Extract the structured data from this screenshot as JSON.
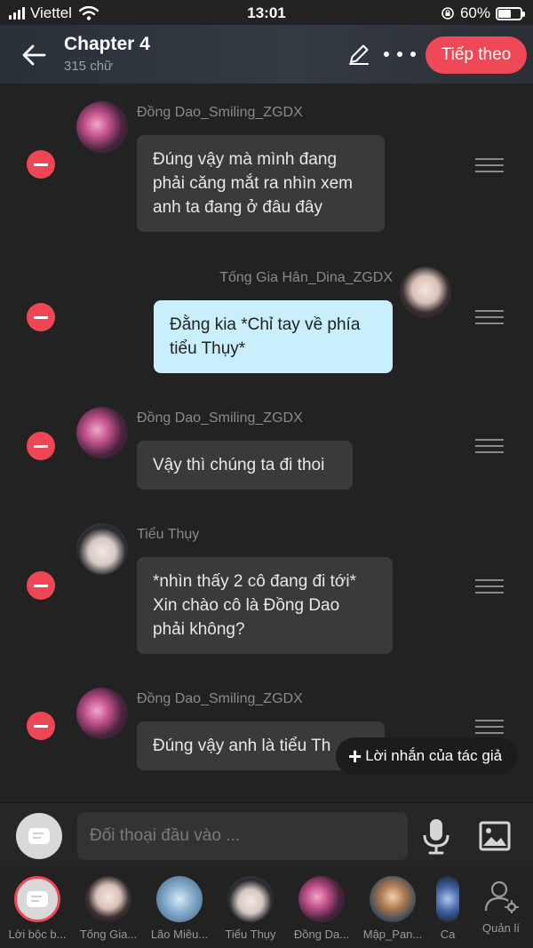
{
  "status_bar": {
    "carrier": "Viettel",
    "time": "13:01",
    "battery_label": "60%",
    "battery_level": 0.6
  },
  "header": {
    "title": "Chapter 4",
    "subtitle": "315 chữ",
    "next_label": "Tiếp theo",
    "accent_color": "#ef4856"
  },
  "messages": [
    {
      "sender": "Đồng Dao_Smiling_ZGDX",
      "lines": [
        "Đúng vậy mà mình đang",
        "phải căng mắt ra nhìn xem",
        "anh ta đang ở đâu đây"
      ],
      "self": false
    },
    {
      "sender": "Tống Gia Hân_Dina_ZGDX",
      "lines": [
        "Đằng kia *Chỉ tay về phía",
        "tiểu Thụy*"
      ],
      "self": true
    },
    {
      "sender": "Đồng Dao_Smiling_ZGDX",
      "lines": [
        "Vậy thì chúng ta đi thoi"
      ],
      "self": false
    },
    {
      "sender": "Tiểu Thụy",
      "lines": [
        "*nhìn thấy 2 cô đang đi tới*",
        "Xin chào cô là Đồng Dao",
        "phải không?"
      ],
      "self": false
    },
    {
      "sender": "Đồng Dao_Smiling_ZGDX",
      "lines": [
        "Đúng vậy anh là tiểu Th"
      ],
      "self": false
    }
  ],
  "author_note": {
    "plus": "+",
    "label": "Lời nhắn của tác giả"
  },
  "input": {
    "placeholder": "Đối thoại đầu vào ..."
  },
  "characters": [
    {
      "name": "Lời bộc b..."
    },
    {
      "name": "Tống Gia..."
    },
    {
      "name": "Lão Miêu..."
    },
    {
      "name": "Tiểu Thụy"
    },
    {
      "name": "Đồng Da..."
    },
    {
      "name": "Mập_Pan..."
    },
    {
      "name": "Ca"
    }
  ],
  "manage_label": "Quản lí",
  "icons": [
    "back-arrow-icon",
    "pencil-icon",
    "more-dots-icon",
    "remove-icon",
    "drag-handle-icon",
    "chat-bubble-icon",
    "microphone-icon",
    "image-icon",
    "user-gear-icon",
    "wifi-icon",
    "signal-icon",
    "battery-icon",
    "orientation-lock-icon"
  ]
}
